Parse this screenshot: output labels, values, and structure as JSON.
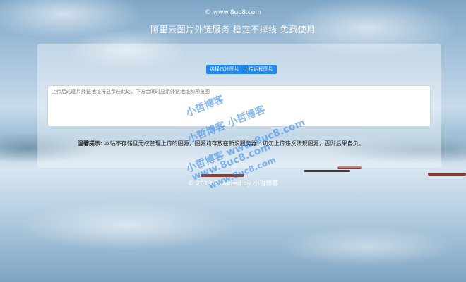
{
  "header": {
    "copyright": "© www.8uc8.com",
    "subtitle": "阿里云图片外链服务 稳定不掉线 免费使用"
  },
  "actions": {
    "select_local": "选择本地图片",
    "upload_remote": "上传远程图片"
  },
  "result_box": {
    "placeholder": "上传后的图片外链地址将显示在此处，下方会同时显示外链地址和预览图"
  },
  "notice": {
    "label": "温馨提示:",
    "text": "本站不存储且无权管理上传的图源，图源均存放在新浪服务器，切勿上传违反法规图源，否则后果自负。"
  },
  "footer": {
    "text": "© 2019 Powered by 小哲博客"
  },
  "watermark": {
    "line1": "小哲博客",
    "line2": "小哲博客 小哲博客",
    "line3": "小哲博客 www.8uc8.com",
    "line4": "www.8uc8.com",
    "line5": "www.8uc8.com"
  },
  "colors": {
    "button": "#1e88f5",
    "watermark": "#2882e6"
  }
}
